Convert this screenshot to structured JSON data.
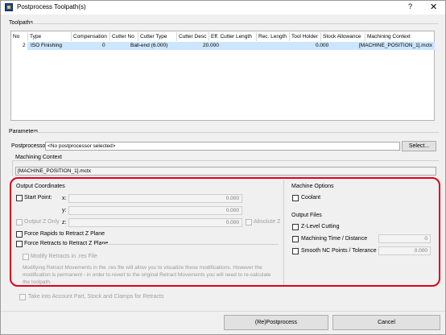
{
  "window": {
    "title": "Postprocess Toolpath(s)",
    "help": "?",
    "close": "✕"
  },
  "toolpaths": {
    "label": "Toolpaths",
    "columns": [
      "No",
      "Type",
      "Compensation",
      "Cutter No",
      "Cutter Type",
      "Cutter Desc",
      "Eff. Cutter Length",
      "Rec. Length",
      "Tool Holder",
      "Stock Allowance",
      "Machining Context"
    ],
    "rows": [
      {
        "no": "2",
        "type": "ISO Finishing",
        "compensation": "",
        "cutter_no": "0",
        "cutter_type": "Ball-end (6.000)",
        "cutter_desc": "",
        "eff_length": "20.000",
        "rec_length": "",
        "tool_holder": "",
        "stock_allowance": "0.000",
        "context": "[MACHINE_POSITION_1].mctx"
      }
    ]
  },
  "parameters": {
    "label": "Parameters",
    "postprocessor_label": "Postprocessor",
    "postprocessor_value": "<No postprocessor selected>",
    "select_button": "Select...",
    "machining_context_label": "Machining Context",
    "machining_context_value": "[MACHINE_POSITION_1].mctx"
  },
  "output_coordinates": {
    "label": "Output Coordinates",
    "start_point": "Start Point:",
    "x_label": "x:",
    "x_value": "0.000",
    "y_label": "y:",
    "y_value": "0.000",
    "z_label": "z:",
    "z_value": "0.000",
    "output_z_only": "Output Z Only",
    "absolute_z": "Absolute Z",
    "force_rapids": "Force Rapids to Retract Z Plane",
    "force_retracts": "Force Retracts to Retract Z Plane",
    "modify_retracts": "Modify Retracts in .res File",
    "modify_note": "Modifying Retract Movements in the .res file will allow you to visualize these modifications. However the modification is permanent - in order to revert to the original Retract Movements you will need to re-calculate the toolpath."
  },
  "machine_options": {
    "label": "Machine Options",
    "coolant": "Coolant"
  },
  "output_files": {
    "label": "Output Files",
    "z_level": "Z-Level Cutting",
    "machining_time": "Machining Time / Distance",
    "machining_time_value": "0",
    "smooth_nc": "Smooth NC Points / Tolerance",
    "smooth_nc_value": "0.000"
  },
  "take_into_account": "Take into Account Part, Stock and Clamps for Retracts",
  "buttons": {
    "postprocess": "(Re)Postprocess",
    "cancel": "Cancel"
  },
  "colors": {
    "highlight": "#e0001a",
    "selection": "#cce6ff"
  }
}
